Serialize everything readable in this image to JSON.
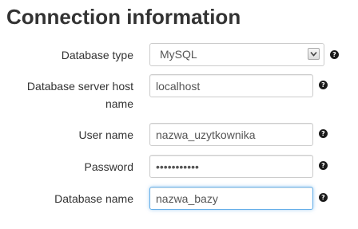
{
  "page_title": "Connection information",
  "fields": {
    "db_type": {
      "label": "Database type",
      "value": "MySQL",
      "help_glyph": "?"
    },
    "db_host": {
      "label": "Database server host name",
      "value": "localhost",
      "help_glyph": "?"
    },
    "user": {
      "label": "User name",
      "value": "nazwa_uzytkownika",
      "help_glyph": "?"
    },
    "password": {
      "label": "Password",
      "value": "***********",
      "help_glyph": "?"
    },
    "db_name": {
      "label": "Database name",
      "value": "nazwa_bazy",
      "help_glyph": "?"
    }
  },
  "colors": {
    "focus_border": "#66afe9",
    "text": "#333333",
    "help_icon": "#1a1a1a"
  }
}
